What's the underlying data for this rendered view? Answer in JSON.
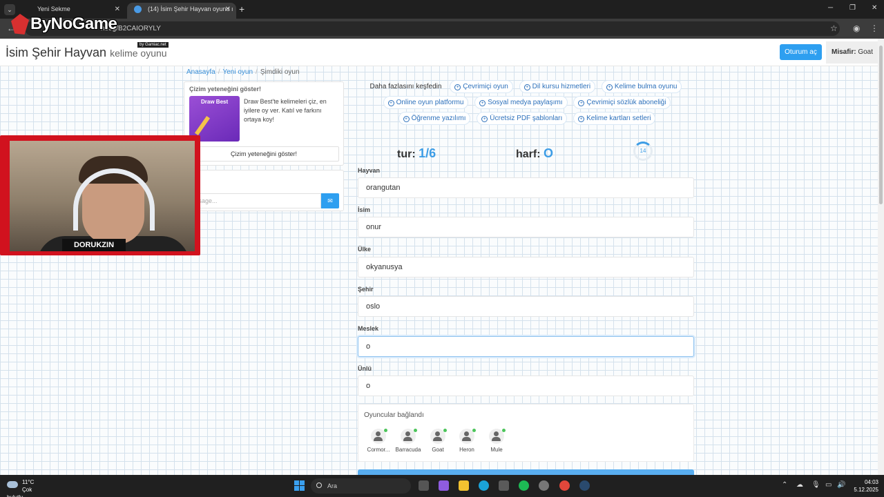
{
  "browser": {
    "tabs": [
      {
        "label": "Yeni Sekme",
        "active": false
      },
      {
        "label": "(14) İsim Şehir Hayvan oyunu ı",
        "active": true
      }
    ],
    "new_tab": "+",
    "url": "net/g/B2CAIORYLY",
    "win_minimize": "─",
    "win_maximize": "❐",
    "win_close": "✕"
  },
  "overlay": {
    "logo": "ByNoGame",
    "logo_sub": "by Gamiac.net",
    "cam_name": "DORUKZIN"
  },
  "header": {
    "title": "İsim Şehir Hayvan",
    "title_sub": "kelime oyunu",
    "login_label": "Oturum aç",
    "guest_label": "Misafir:",
    "guest_name": "Goat"
  },
  "breadcrumb": [
    "Anasayfa",
    "Yeni oyun",
    "Şimdiki oyun"
  ],
  "promo": {
    "title": "Çizim yeteneğini göster!",
    "image_title": "Draw Best",
    "text": "Draw Best'te kelimeleri çiz, en iyilere oy ver. Katıl ve farkını ortaya koy!",
    "button": "Çizim yeteneğini göster!"
  },
  "chat": {
    "title": "bet",
    "placeholder": "essage..."
  },
  "explore": {
    "label": "Daha fazlasını keşfedin",
    "tags": [
      "Çevrimiçi oyun",
      "Dil kursu hizmetleri",
      "Kelime bulma oyunu",
      "Online oyun platformu",
      "Sosyal medya paylaşımı",
      "Çevrimiçi sözlük aboneliği",
      "Öğrenme yazılımı",
      "Ücretsiz PDF şablonları",
      "Kelime kartları setleri"
    ]
  },
  "game": {
    "round_label": "tur:",
    "round_value": "1/6",
    "letter_label": "harf:",
    "letter_value": "O",
    "timer": "14",
    "fields": [
      {
        "label": "Hayvan",
        "value": "orangutan"
      },
      {
        "label": "İsim",
        "value": "onur"
      },
      {
        "label": "Ülke",
        "value": "okyanusya"
      },
      {
        "label": "Şehir",
        "value": "oslo"
      },
      {
        "label": "Meslek",
        "value": "o"
      },
      {
        "label": "Ünlü",
        "value": "o"
      }
    ]
  },
  "players": {
    "title": "Oyuncular bağlandı",
    "list": [
      "Cormor...",
      "Barracuda",
      "Goat",
      "Heron",
      "Mule"
    ]
  },
  "taskbar": {
    "temp": "11°C",
    "weather": "Çok bulutlu",
    "search": "Ara",
    "time": "04:03",
    "date": "5.12.2025"
  }
}
